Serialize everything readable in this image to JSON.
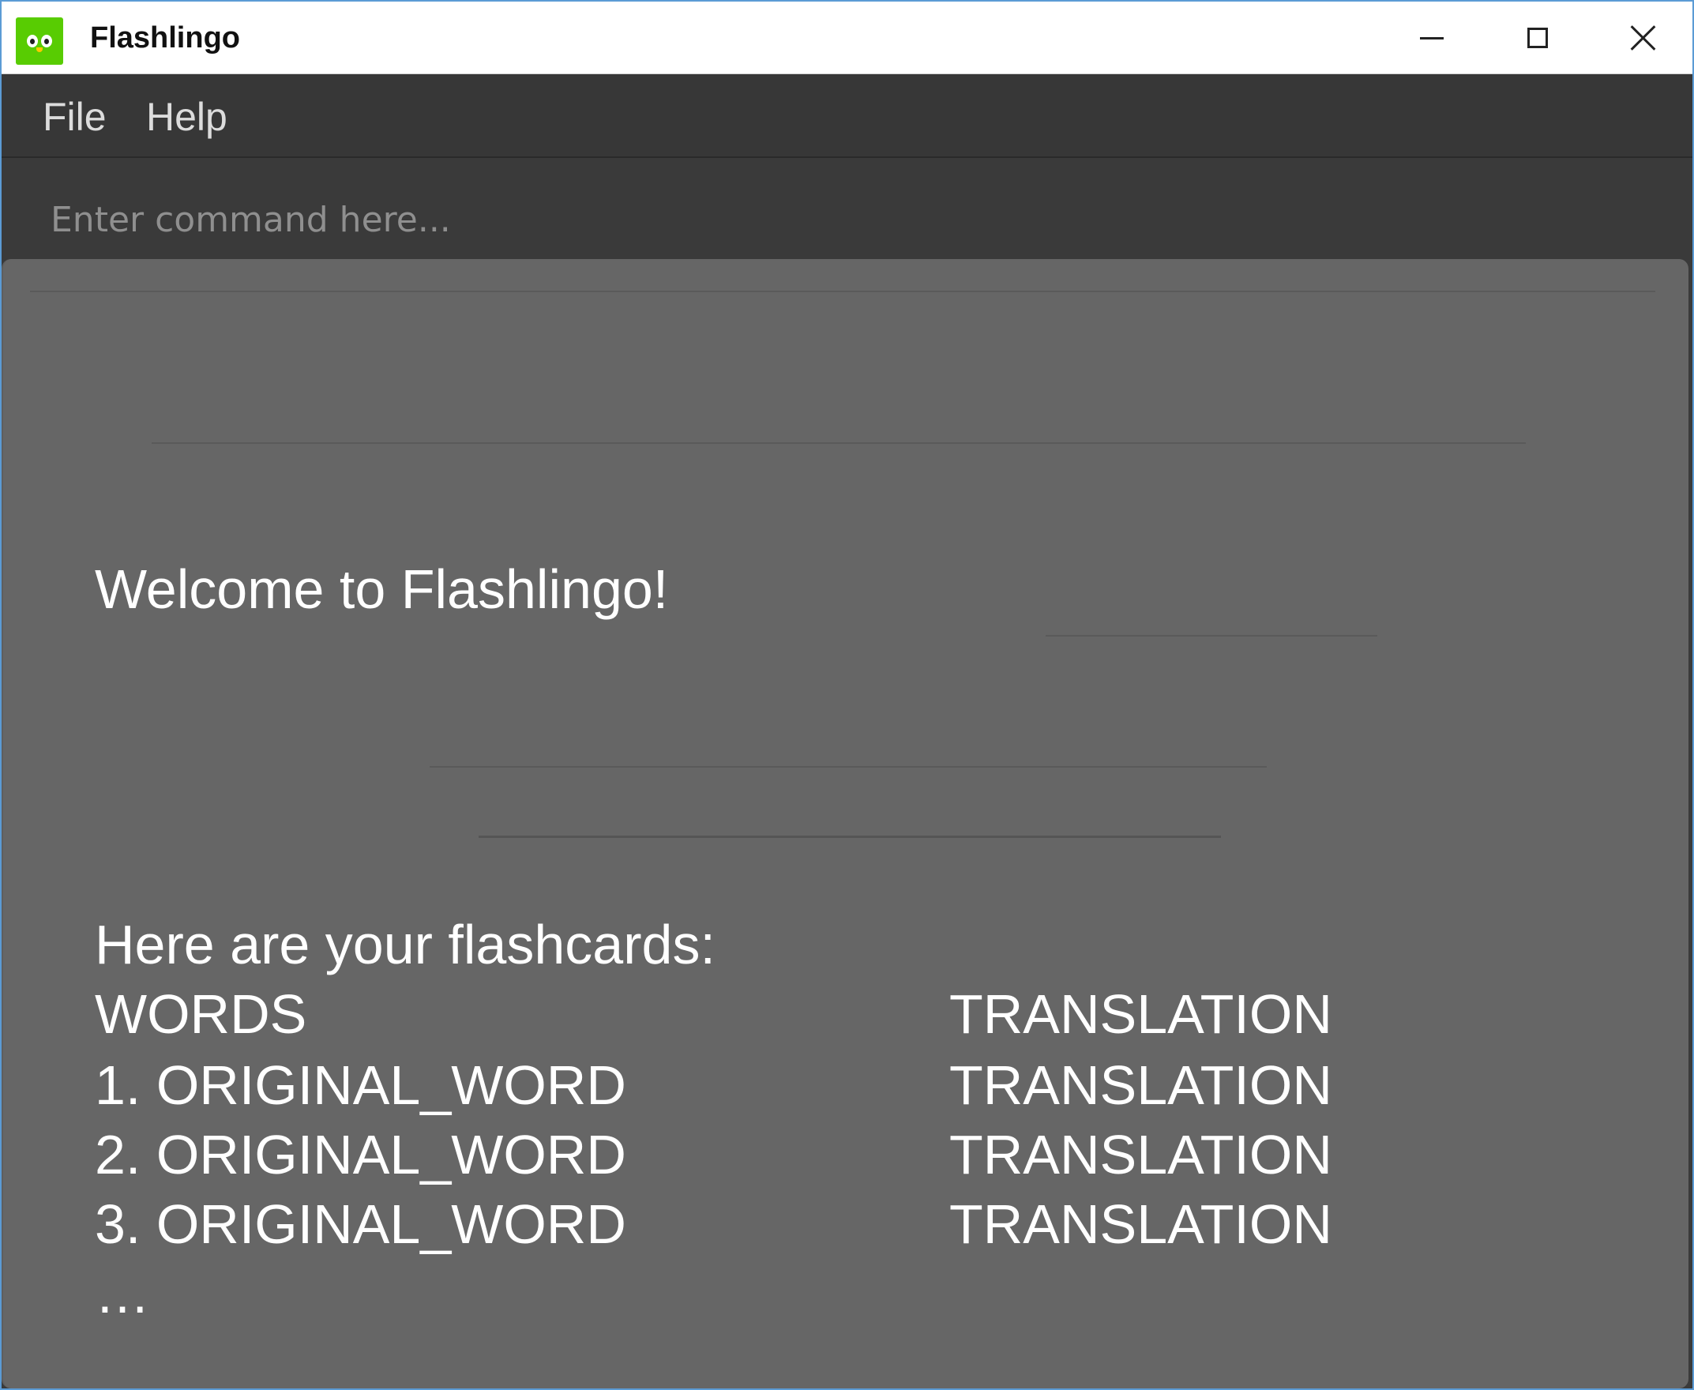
{
  "window": {
    "title": "Flashlingo",
    "icon": "duolingo-owl-icon",
    "controls": [
      "minimize-icon",
      "maximize-icon",
      "close-icon"
    ]
  },
  "menu": {
    "items": [
      {
        "label": "File"
      },
      {
        "label": "Help"
      }
    ]
  },
  "command": {
    "placeholder": "Enter command here...",
    "value": ""
  },
  "result": {
    "welcome": "Welcome to Flashlingo!",
    "intro": "Here are your flashcards:",
    "header": {
      "word": "WORDS",
      "translation": "TRANSLATION"
    },
    "rows": [
      {
        "word": "1. ORIGINAL_WORD",
        "translation": "TRANSLATION"
      },
      {
        "word": "2. ORIGINAL_WORD",
        "translation": "TRANSLATION"
      },
      {
        "word": "3. ORIGINAL_WORD",
        "translation": "TRANSLATION"
      }
    ],
    "ellipsis": "…"
  },
  "colors": {
    "title_bar": "#ffffff",
    "menu_bar": "#373737",
    "command_bar": "#3a3a3a",
    "result_panel": "#666666",
    "result_text": "#ffffff",
    "icon_green": "#58cc02",
    "window_border": "#5b9bd5"
  }
}
